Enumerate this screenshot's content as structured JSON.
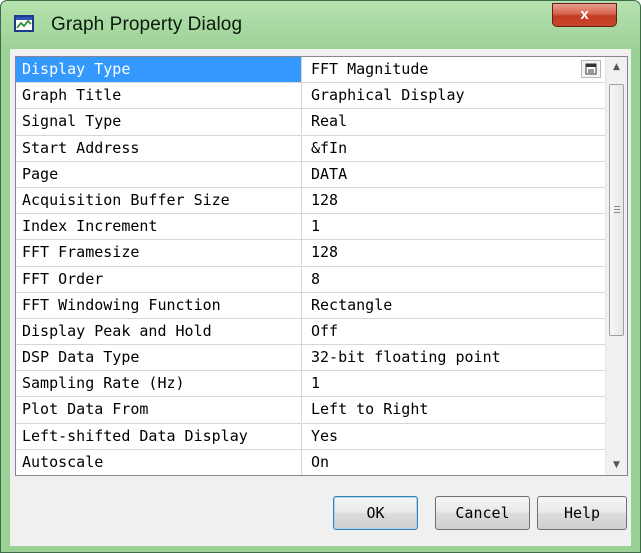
{
  "window": {
    "title": "Graph Property Dialog",
    "close_glyph": "x",
    "icon": "graph-app-icon"
  },
  "properties": [
    {
      "name": "Display Type",
      "value": "FFT Magnitude",
      "selected": true
    },
    {
      "name": "Graph Title",
      "value": "Graphical Display"
    },
    {
      "name": "Signal Type",
      "value": "Real"
    },
    {
      "name": "Start Address",
      "value": "&fIn"
    },
    {
      "name": "Page",
      "value": "DATA"
    },
    {
      "name": "Acquisition Buffer Size",
      "value": "128"
    },
    {
      "name": "Index Increment",
      "value": "1"
    },
    {
      "name": "FFT Framesize",
      "value": "128"
    },
    {
      "name": "FFT Order",
      "value": "8"
    },
    {
      "name": "FFT Windowing Function",
      "value": "Rectangle"
    },
    {
      "name": "Display Peak and Hold",
      "value": "Off"
    },
    {
      "name": "DSP Data Type",
      "value": "32-bit floating point"
    },
    {
      "name": "Sampling Rate (Hz)",
      "value": "1"
    },
    {
      "name": "Plot Data From",
      "value": "Left to Right"
    },
    {
      "name": "Left-shifted Data Display",
      "value": "Yes"
    },
    {
      "name": "Autoscale",
      "value": "On"
    }
  ],
  "buttons": {
    "ok": "OK",
    "cancel": "Cancel",
    "help": "Help"
  },
  "colors": {
    "selection": "#3399ff",
    "titlebar": "#9cd195",
    "close": "#c23b22"
  }
}
